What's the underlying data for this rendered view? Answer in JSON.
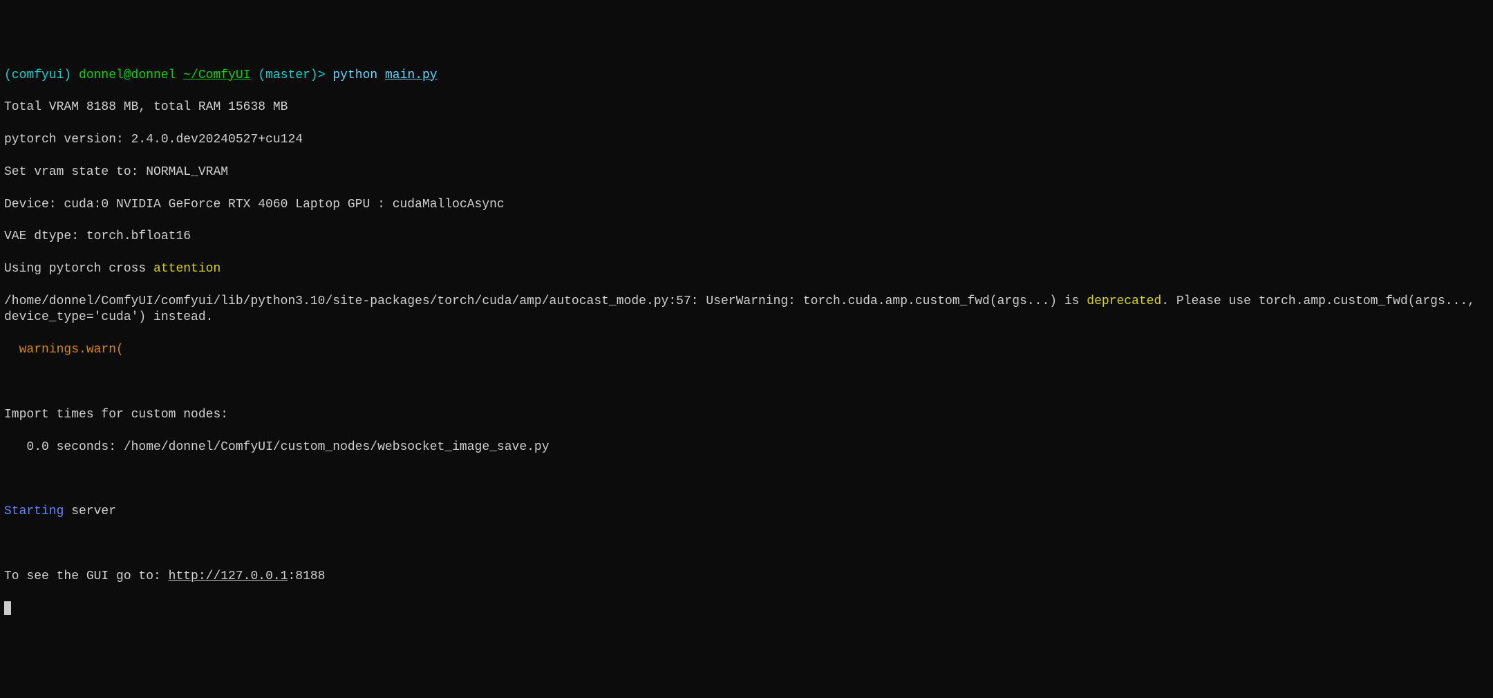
{
  "prompt": {
    "env": "(comfyui)",
    "user_host": "donnel@donnel",
    "path": "~/ComfyUI",
    "branch": "(master)",
    "symbol": ">",
    "cmd_python": "python",
    "cmd_file": "main.py"
  },
  "lines": {
    "vram": "Total VRAM 8188 MB, total RAM 15638 MB",
    "pytorch": "pytorch version: 2.4.0.dev20240527+cu124",
    "vram_state": "Set vram state to: NORMAL_VRAM",
    "device": "Device: cuda:0 NVIDIA GeForce RTX 4060 Laptop GPU : cudaMallocAsync",
    "vae": "VAE dtype: torch.bfloat16",
    "cross_a": "Using pytorch cross ",
    "cross_b": "attention",
    "warn_a": "/home/donnel/ComfyUI/comfyui/lib/python3.10/site-packages/torch/cuda/amp/autocast_mode.py:57: UserWarning: torch.cuda.amp.custom_fwd(args...) is ",
    "warn_dep": "deprecated",
    "warn_b": ". Please use torch.amp.custom_fwd(args..., device_type='cuda') instead.",
    "warn_indent": "warnings.warn(",
    "import_header": "Import times for custom nodes:",
    "import_time": "   0.0 seconds: /home/donnel/ComfyUI/custom_nodes/websocket_image_save.py",
    "starting_a": "Starting",
    "starting_b": " server",
    "gui_a": "To see the GUI go to: ",
    "gui_url": "http://127.0.0.1",
    "gui_port": ":8188"
  }
}
